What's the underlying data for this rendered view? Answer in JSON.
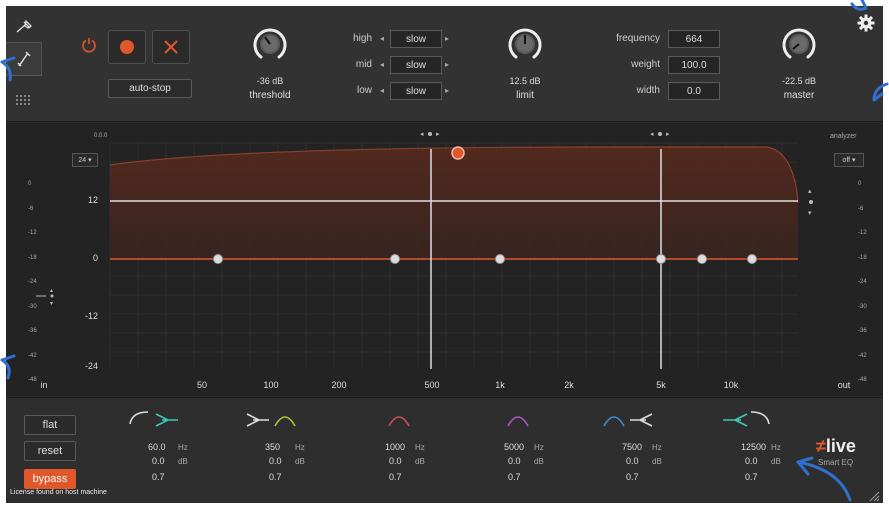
{
  "top": {
    "autostop_label": "auto-stop",
    "threshold_value": "-36 dB",
    "threshold_label": "threshold",
    "limit_value": "12.5 dB",
    "limit_label": "limit",
    "master_value": "-22.5 dB",
    "master_label": "master",
    "speed_rows": [
      {
        "label": "high",
        "value": "slow"
      },
      {
        "label": "mid",
        "value": "slow"
      },
      {
        "label": "low",
        "value": "slow"
      }
    ],
    "fields": [
      {
        "label": "frequency",
        "value": "664"
      },
      {
        "label": "weight",
        "value": "100.0"
      },
      {
        "label": "width",
        "value": "0.0"
      }
    ]
  },
  "eq": {
    "left_readout": "0.0.0",
    "left_dropdown": "24 ▾",
    "analyzer_label": "analyzer",
    "analyzer_dropdown": "off ▾",
    "in_label": "in",
    "out_label": "out",
    "gain_labels": [
      "12",
      "0",
      "-12",
      "-24"
    ],
    "freq_labels": [
      "50",
      "100",
      "200",
      "500",
      "1k",
      "2k",
      "5k",
      "10k"
    ],
    "meter_scale": [
      "0",
      "-6",
      "-12",
      "-18",
      "-24",
      "-30",
      "-36",
      "-42",
      "-48"
    ]
  },
  "bottom": {
    "flat_label": "flat",
    "reset_label": "reset",
    "bypass_label": "bypass",
    "license_text": "License found on host machine",
    "brand_logo": "live",
    "brand_sub": "Smart EQ",
    "bands": [
      {
        "freq": "60.0",
        "freq_unit": "Hz",
        "gain": "0.0",
        "gain_unit": "dB",
        "q": "0.7",
        "color": "#3cc7b6"
      },
      {
        "freq": "350",
        "freq_unit": "Hz",
        "gain": "0.0",
        "gain_unit": "dB",
        "q": "0.7",
        "color": "#a8c73c"
      },
      {
        "freq": "1000",
        "freq_unit": "Hz",
        "gain": "0.0",
        "gain_unit": "dB",
        "q": "0.7",
        "color": "#d84a5a"
      },
      {
        "freq": "5000",
        "freq_unit": "Hz",
        "gain": "0.0",
        "gain_unit": "dB",
        "q": "0.7",
        "color": "#a65ac7"
      },
      {
        "freq": "7500",
        "freq_unit": "Hz",
        "gain": "0.0",
        "gain_unit": "dB",
        "q": "0.7",
        "color": "#3a8fd8"
      },
      {
        "freq": "12500",
        "freq_unit": "Hz",
        "gain": "0.0",
        "gain_unit": "dB",
        "q": "0.7",
        "color": "#3cc7b6"
      }
    ]
  },
  "colors": {
    "accent": "#e0572b",
    "background": "#2b2b2b"
  }
}
